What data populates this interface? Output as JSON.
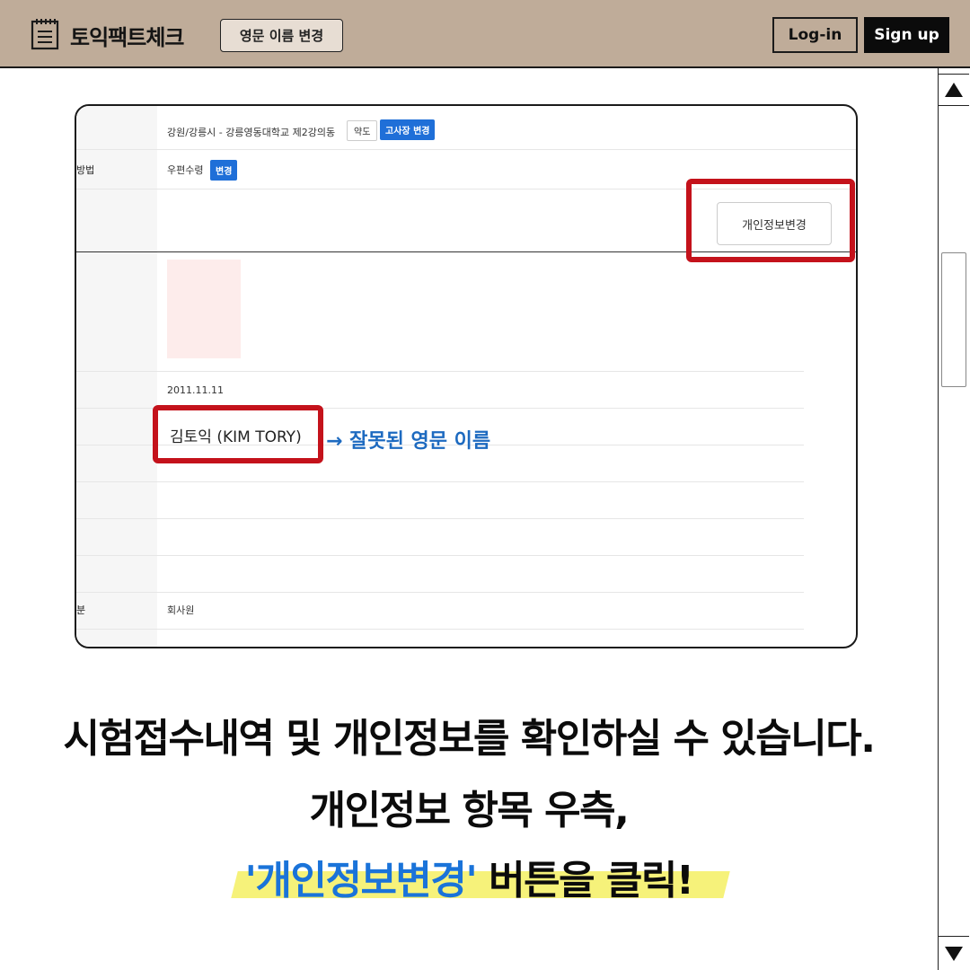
{
  "header": {
    "logo_text": "토익팩트체크",
    "name_change_button": "영문 이름 변경",
    "login_button": "Log-in",
    "signup_button": "Sign up"
  },
  "screenshot": {
    "venue_text": "강원/강릉시 - 강릉영동대학교 제2강의동",
    "map_tag": "약도",
    "venue_change_tag": "고사장 변경",
    "method_label": "방법",
    "method_value": "우편수령",
    "method_change_tag": "변경",
    "edit_info_button": "개인정보변경",
    "birth_date": "2011.11.11",
    "name_value": "김토익 (KIM TORY)",
    "annotation": "→ 잘못된 영문 이름",
    "category_label": "분",
    "category_value": "회사원"
  },
  "captions": {
    "line1": "시험접수내역 및 개인정보를 확인하실 수 있습니다.",
    "line2": "개인정보 항목 우측,",
    "line3_highlight": "'개인정보변경'",
    "line3_rest": " 버튼을 클릭!"
  },
  "colors": {
    "header_bg": "#bfac99",
    "highlight_red": "#c4121b",
    "accent_blue": "#1a73d9",
    "marker_yellow": "#f6f27a"
  },
  "icons": {
    "logo": "notepad-icon",
    "scroll_up": "triangle-up-icon",
    "scroll_down": "triangle-down-icon"
  }
}
